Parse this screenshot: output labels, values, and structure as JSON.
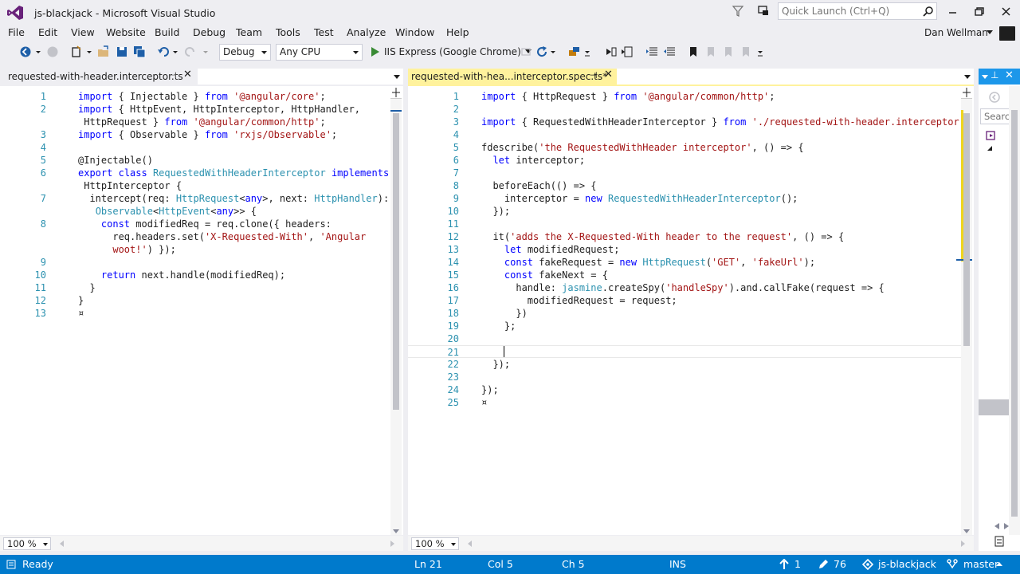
{
  "window": {
    "title": "js-blackjack - Microsoft Visual Studio",
    "quick_launch_placeholder": "Quick Launch (Ctrl+Q)"
  },
  "menu": {
    "items": [
      "File",
      "Edit",
      "View",
      "Website",
      "Build",
      "Debug",
      "Team",
      "Tools",
      "Test",
      "Analyze",
      "Window",
      "Help"
    ],
    "user": "Dan Wellman"
  },
  "toolbar": {
    "config": "Debug",
    "platform": "Any CPU",
    "run_target": "IIS Express (Google Chrome)"
  },
  "left_editor": {
    "tab_title": "requested-with-header.interceptor.ts",
    "zoom": "100 %",
    "lines": [
      {
        "n": "1",
        "segs": [
          [
            "kw",
            "import"
          ],
          [
            "",
            "·{·Injectable·}·"
          ],
          [
            "kw",
            "from"
          ],
          [
            "",
            "·"
          ],
          [
            "str",
            "'@angular/core'"
          ],
          [
            "",
            ";"
          ]
        ]
      },
      {
        "n": "2",
        "segs": [
          [
            "kw",
            "import"
          ],
          [
            "",
            "·{·HttpEvent,·HttpInterceptor,·HttpHandler,·"
          ]
        ]
      },
      {
        "n": "",
        "segs": [
          [
            "",
            "·HttpRequest·}·"
          ],
          [
            "kw",
            "from"
          ],
          [
            "",
            "·"
          ],
          [
            "str",
            "'@angular/common/http'"
          ],
          [
            "",
            ";"
          ]
        ]
      },
      {
        "n": "3",
        "segs": [
          [
            "kw",
            "import"
          ],
          [
            "",
            "·{·Observable·}·"
          ],
          [
            "kw",
            "from"
          ],
          [
            "",
            "·"
          ],
          [
            "str",
            "'rxjs/Observable'"
          ],
          [
            "",
            ";"
          ]
        ]
      },
      {
        "n": "4",
        "segs": []
      },
      {
        "n": "5",
        "segs": [
          [
            "",
            "@Injectable()"
          ]
        ]
      },
      {
        "n": "6",
        "segs": [
          [
            "kw",
            "export"
          ],
          [
            "",
            "·"
          ],
          [
            "kw",
            "class"
          ],
          [
            "",
            "·"
          ],
          [
            "cls",
            "RequestedWithHeaderInterceptor"
          ],
          [
            "",
            "·"
          ],
          [
            "kw",
            "implements"
          ],
          [
            "",
            "·"
          ]
        ]
      },
      {
        "n": "",
        "segs": [
          [
            "",
            "·HttpInterceptor·{"
          ]
        ]
      },
      {
        "n": "7",
        "segs": [
          [
            "",
            "··intercept(req:·"
          ],
          [
            "ty",
            "HttpRequest"
          ],
          [
            "",
            "<"
          ],
          [
            "kw",
            "any"
          ],
          [
            "",
            ">,·next:·"
          ],
          [
            "ty",
            "HttpHandler"
          ],
          [
            "",
            "):·"
          ]
        ]
      },
      {
        "n": "",
        "segs": [
          [
            "",
            "···"
          ],
          [
            "ty",
            "Observable"
          ],
          [
            "",
            "<"
          ],
          [
            "ty",
            "HttpEvent"
          ],
          [
            "",
            "<"
          ],
          [
            "kw",
            "any"
          ],
          [
            "",
            ">>·{"
          ]
        ]
      },
      {
        "n": "8",
        "segs": [
          [
            "",
            "····"
          ],
          [
            "kw",
            "const"
          ],
          [
            "",
            "·modifiedReq·=·req.clone({·headers:·"
          ]
        ]
      },
      {
        "n": "",
        "segs": [
          [
            "",
            "······req.headers.set("
          ],
          [
            "str",
            "'X-Requested-With'"
          ],
          [
            "",
            ",·"
          ],
          [
            "str",
            "'Angular"
          ]
        ]
      },
      {
        "n": "",
        "segs": [
          [
            "str",
            "······woot!'"
          ],
          [
            "",
            ")·});"
          ]
        ]
      },
      {
        "n": "9",
        "segs": []
      },
      {
        "n": "10",
        "segs": [
          [
            "",
            "····"
          ],
          [
            "kw",
            "return"
          ],
          [
            "",
            "·next.handle(modifiedReq);"
          ]
        ]
      },
      {
        "n": "11",
        "segs": [
          [
            "",
            "··}"
          ]
        ]
      },
      {
        "n": "12",
        "segs": [
          [
            "",
            "}"
          ]
        ]
      },
      {
        "n": "13",
        "segs": [
          [
            "",
            "¤"
          ]
        ]
      }
    ]
  },
  "right_editor": {
    "tab_title": "requested-with-hea...interceptor.spec.ts*",
    "zoom": "100 %",
    "lines": [
      {
        "n": "1",
        "segs": [
          [
            "kw",
            "import"
          ],
          [
            "",
            "·{·HttpRequest·}·"
          ],
          [
            "kw",
            "from"
          ],
          [
            "",
            "·"
          ],
          [
            "str",
            "'@angular/common/http'"
          ],
          [
            "",
            ";"
          ]
        ]
      },
      {
        "n": "2",
        "segs": []
      },
      {
        "n": "3",
        "segs": [
          [
            "kw",
            "import"
          ],
          [
            "",
            "·{·RequestedWithHeaderInterceptor·}·"
          ],
          [
            "kw",
            "from"
          ],
          [
            "",
            "·"
          ],
          [
            "str",
            "'./requested-with-header.interceptor'"
          ],
          [
            "",
            ";"
          ]
        ]
      },
      {
        "n": "4",
        "segs": []
      },
      {
        "n": "5",
        "segs": [
          [
            "",
            "fdescribe("
          ],
          [
            "str",
            "'the·RequestedWithHeader·interceptor'"
          ],
          [
            "",
            ",·()·=>·{"
          ]
        ]
      },
      {
        "n": "6",
        "segs": [
          [
            "",
            "··"
          ],
          [
            "kw",
            "let"
          ],
          [
            "",
            "·interceptor;"
          ]
        ]
      },
      {
        "n": "7",
        "segs": []
      },
      {
        "n": "8",
        "segs": [
          [
            "",
            "··beforeEach(()·=>·{"
          ]
        ]
      },
      {
        "n": "9",
        "segs": [
          [
            "",
            "····interceptor·=·"
          ],
          [
            "kw",
            "new"
          ],
          [
            "",
            "·"
          ],
          [
            "cls",
            "RequestedWithHeaderInterceptor"
          ],
          [
            "",
            "();"
          ]
        ]
      },
      {
        "n": "10",
        "segs": [
          [
            "",
            "··});"
          ]
        ]
      },
      {
        "n": "11",
        "segs": []
      },
      {
        "n": "12",
        "segs": [
          [
            "",
            "··it("
          ],
          [
            "str",
            "'adds·the·X-Requested-With·header·to·the·request'"
          ],
          [
            "",
            ",·()·=>·{"
          ]
        ]
      },
      {
        "n": "13",
        "segs": [
          [
            "",
            "····"
          ],
          [
            "kw",
            "let"
          ],
          [
            "",
            "·modifiedRequest;"
          ]
        ]
      },
      {
        "n": "14",
        "segs": [
          [
            "",
            "····"
          ],
          [
            "kw",
            "const"
          ],
          [
            "",
            "·fakeRequest·=·"
          ],
          [
            "kw",
            "new"
          ],
          [
            "",
            "·"
          ],
          [
            "ty",
            "HttpRequest"
          ],
          [
            "",
            "("
          ],
          [
            "str",
            "'GET'"
          ],
          [
            "",
            ",·"
          ],
          [
            "str",
            "'fakeUrl'"
          ],
          [
            "",
            ");"
          ]
        ]
      },
      {
        "n": "15",
        "segs": [
          [
            "",
            "····"
          ],
          [
            "kw",
            "const"
          ],
          [
            "",
            "·fakeNext·=·{"
          ]
        ]
      },
      {
        "n": "16",
        "segs": [
          [
            "",
            "······handle:·"
          ],
          [
            "cls",
            "jasmine"
          ],
          [
            "",
            ".createSpy("
          ],
          [
            "str",
            "'handleSpy'"
          ],
          [
            "",
            ").and.callFake(request·=>·{"
          ]
        ]
      },
      {
        "n": "17",
        "segs": [
          [
            "",
            "········modifiedRequest·=·request;"
          ]
        ]
      },
      {
        "n": "18",
        "segs": [
          [
            "",
            "······})"
          ]
        ]
      },
      {
        "n": "19",
        "segs": [
          [
            "",
            "····};"
          ]
        ]
      },
      {
        "n": "20",
        "segs": []
      },
      {
        "n": "21",
        "segs": []
      },
      {
        "n": "22",
        "segs": [
          [
            "",
            "··});"
          ]
        ]
      },
      {
        "n": "23",
        "segs": []
      },
      {
        "n": "24",
        "segs": [
          [
            "",
            "});"
          ]
        ]
      },
      {
        "n": "25",
        "segs": [
          [
            "",
            "¤"
          ]
        ]
      }
    ]
  },
  "side_panel": {
    "search_placeholder": "Search S"
  },
  "status": {
    "ready": "Ready",
    "ln": "Ln 21",
    "col": "Col 5",
    "ch": "Ch 5",
    "mode": "INS",
    "up_count": "1",
    "edit_count": "76",
    "project": "js-blackjack",
    "branch": "master"
  },
  "colors": {
    "accent": "#007acc",
    "active_tab": "#fff29d",
    "keyword": "#0000ff",
    "string": "#a31515",
    "type": "#2b91af"
  }
}
